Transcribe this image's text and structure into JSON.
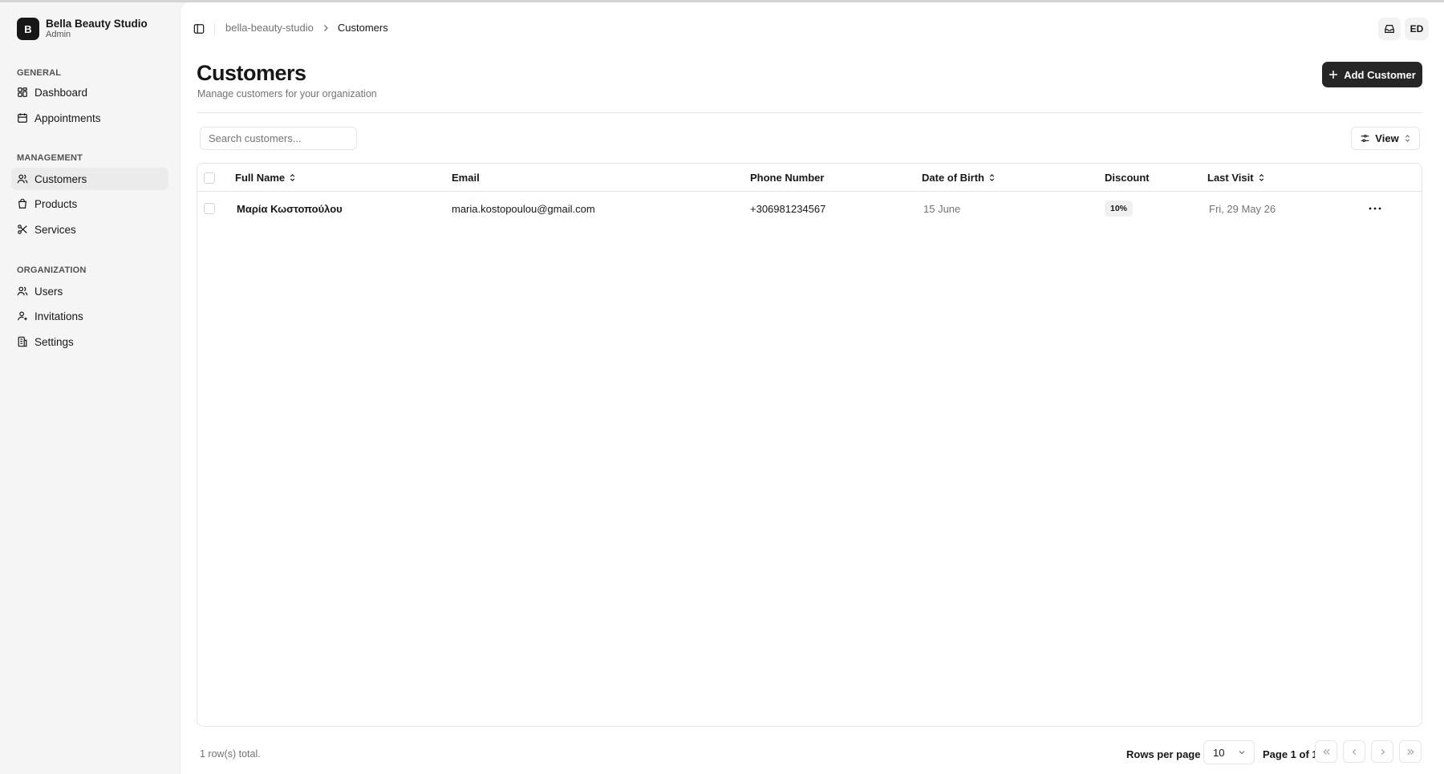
{
  "sidebar": {
    "org_initial": "B",
    "org_name": "Bella Beauty Studio",
    "org_role": "Admin",
    "sections": [
      {
        "title": "GENERAL",
        "items": [
          {
            "label": "Dashboard",
            "icon": "dashboard-icon"
          },
          {
            "label": "Appointments",
            "icon": "calendar-icon"
          }
        ]
      },
      {
        "title": "MANAGEMENT",
        "items": [
          {
            "label": "Customers",
            "icon": "users-icon",
            "active": true
          },
          {
            "label": "Products",
            "icon": "shopping-bag-icon"
          },
          {
            "label": "Services",
            "icon": "scissors-icon"
          }
        ]
      },
      {
        "title": "ORGANIZATION",
        "items": [
          {
            "label": "Users",
            "icon": "users-icon"
          },
          {
            "label": "Invitations",
            "icon": "user-plus-icon"
          },
          {
            "label": "Settings",
            "icon": "building-icon"
          }
        ]
      }
    ]
  },
  "header": {
    "breadcrumb_root": "bella-beauty-studio",
    "breadcrumb_current": "Customers",
    "avatar_initials": "ED"
  },
  "page": {
    "title": "Customers",
    "subtitle": "Manage customers for your organization",
    "add_button": "Add Customer"
  },
  "toolbar": {
    "search_placeholder": "Search customers...",
    "view_button": "View"
  },
  "table": {
    "columns": [
      "Full Name",
      "Email",
      "Phone Number",
      "Date of Birth",
      "Discount",
      "Last Visit"
    ],
    "rows": [
      {
        "full_name": "Μαρία Κωστοπούλου",
        "email": "maria.kostopoulou@gmail.com",
        "phone": "+306981234567",
        "dob": "15 June",
        "discount": "10%",
        "last_visit": "Fri, 29 May 26"
      }
    ]
  },
  "footer": {
    "total": "1 row(s) total.",
    "rows_per_page_label": "Rows per page",
    "rows_per_page_value": "10",
    "page_info": "Page 1 of 1"
  },
  "colors": {
    "primary_button": "#262626",
    "sidebar_bg": "#f5f5f5",
    "active_item_bg": "#ebebeb"
  }
}
